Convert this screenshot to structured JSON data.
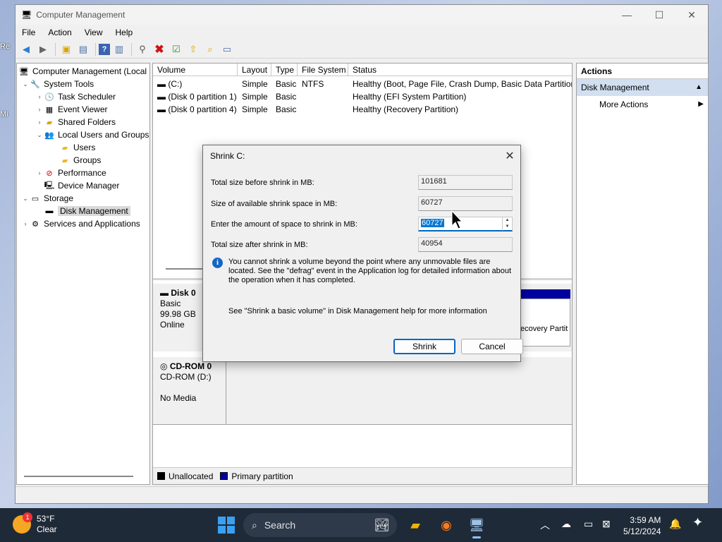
{
  "window": {
    "title": "Computer Management",
    "controls": {
      "minimize": "—",
      "maximize": "☐",
      "close": "✕"
    }
  },
  "menu": [
    "File",
    "Action",
    "View",
    "Help"
  ],
  "tree": {
    "root": "Computer Management (Local",
    "system_tools": "System Tools",
    "task_scheduler": "Task Scheduler",
    "event_viewer": "Event Viewer",
    "shared_folders": "Shared Folders",
    "local_users": "Local Users and Groups",
    "users": "Users",
    "groups": "Groups",
    "performance": "Performance",
    "device_manager": "Device Manager",
    "storage": "Storage",
    "disk_management": "Disk Management",
    "services": "Services and Applications"
  },
  "volume_table": {
    "headers": [
      "Volume",
      "Layout",
      "Type",
      "File System",
      "Status"
    ],
    "rows": [
      [
        "(C:)",
        "Simple",
        "Basic",
        "NTFS",
        "Healthy (Boot, Page File, Crash Dump, Basic Data Partition)"
      ],
      [
        "(Disk 0 partition 1)",
        "Simple",
        "Basic",
        "",
        "Healthy (EFI System Partition)"
      ],
      [
        "(Disk 0 partition 4)",
        "Simple",
        "Basic",
        "",
        "Healthy (Recovery Partition)"
      ]
    ]
  },
  "disks": {
    "disk0": {
      "name": "Disk 0",
      "type": "Basic",
      "size": "99.98 GB",
      "state": "Online",
      "partition_label": "ecovery Partit"
    },
    "cdrom0": {
      "name": "CD-ROM 0",
      "drive": "CD-ROM (D:)",
      "media": "No Media"
    }
  },
  "legend": {
    "unallocated": "Unallocated",
    "primary": "Primary partition",
    "unallocated_color": "#000000",
    "primary_color": "#0000a0"
  },
  "actions": {
    "header": "Actions",
    "section": "Disk Management",
    "more": "More Actions"
  },
  "dialog": {
    "title": "Shrink C:",
    "total_before_label": "Total size before shrink in MB:",
    "total_before_value": "101681",
    "available_label": "Size of available shrink space in MB:",
    "available_value": "60727",
    "amount_label": "Enter the amount of space to shrink in MB:",
    "amount_value": "60727",
    "total_after_label": "Total size after shrink in MB:",
    "total_after_value": "40954",
    "info_text": "You cannot shrink a volume beyond the point where any unmovable files are located. See the \"defrag\" event in the Application log for detailed information about the operation when it has completed.",
    "help_text": "See \"Shrink a basic volume\" in Disk Management help for more information",
    "shrink_button": "Shrink",
    "cancel_button": "Cancel"
  },
  "taskbar": {
    "temperature": "53°F",
    "condition": "Clear",
    "weather_badge": "1",
    "search_placeholder": "Search",
    "time": "3:59 AM",
    "date": "5/12/2024"
  },
  "desktop_fragments": [
    "Re",
    "Mi"
  ],
  "colors": {
    "accent": "#0067c0",
    "selection": "#0078d7",
    "taskbar": "#1f2a38"
  }
}
